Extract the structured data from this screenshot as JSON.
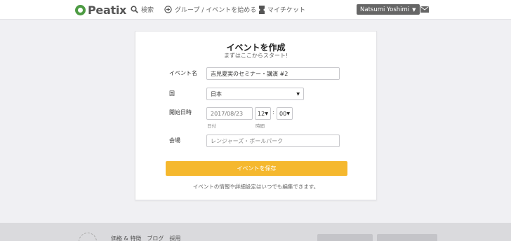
{
  "header": {
    "logo_text": "Peatix",
    "search_label": "検索",
    "create_label": "グループ / イベントを始める",
    "tickets_label": "マイチケット",
    "user_name": "Natsumi Yoshimi"
  },
  "form": {
    "title": "イベントを作成",
    "subtitle": "まずはここからスタート!",
    "name_label": "イベント名",
    "name_value": "吉見夏実のセミナー・講演 #2",
    "country_label": "国",
    "country_value": "日本",
    "start_label": "開始日時",
    "date_value": "2017/08/23",
    "hour_value": "12",
    "minute_value": "00",
    "date_sublabel": "日付",
    "time_sublabel": "時間",
    "venue_label": "会場",
    "venue_placeholder": "レンジャーズ・ボールパーク",
    "save_label": "イベントを保存",
    "note": "イベントの情報や詳細設定はいつでも編集できます。"
  },
  "footer": {
    "links": [
      "価格 & 特徴",
      "ブログ",
      "採用"
    ]
  },
  "colors": {
    "brand_green": "#4d9b43",
    "save_button": "#f5b82e",
    "user_button": "#666666"
  },
  "icons": {
    "search": "search-icon",
    "create": "plus-circle-icon",
    "tickets": "ticket-icon",
    "mail": "mail-icon",
    "dropdown": "caret-down-icon"
  }
}
